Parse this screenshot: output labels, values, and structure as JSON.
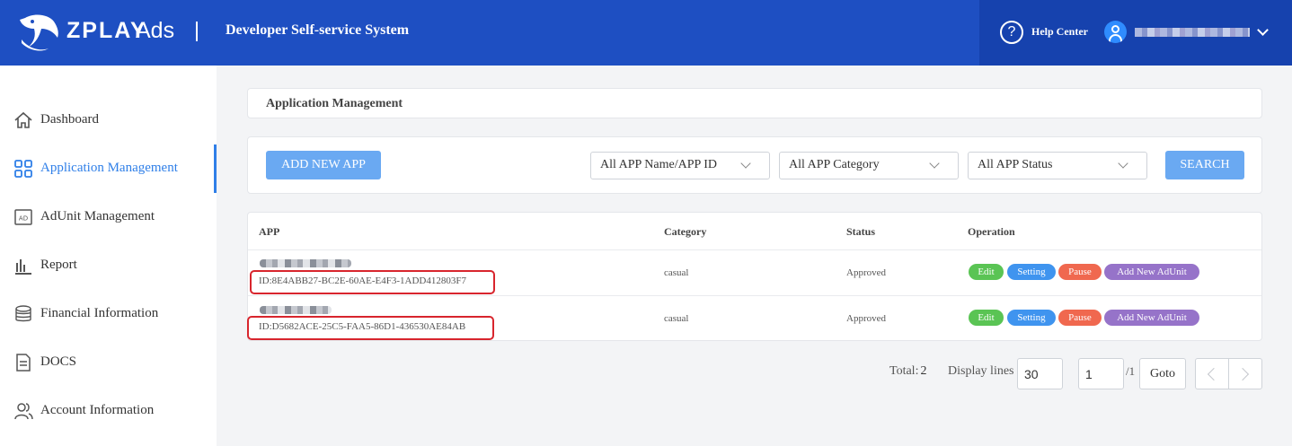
{
  "header": {
    "logo_word": "ZPLAY",
    "logo_ads": "Ads",
    "system_title": "Developer Self-service System",
    "help_icon_glyph": "?",
    "help_label": "Help Center",
    "user_icon": "user-icon",
    "dropdown_icon": "chevron-down-icon",
    "colors": {
      "header_bg": "#1e4fc2",
      "header_right_bg": "#1642ae",
      "accent": "#2f7fe8"
    }
  },
  "sidebar": {
    "items": [
      {
        "label": "Dashboard",
        "icon": "home-icon"
      },
      {
        "label": "Application Management",
        "icon": "grid-icon",
        "active": true
      },
      {
        "label": "AdUnit Management",
        "icon": "ad-icon"
      },
      {
        "label": "Report",
        "icon": "bar-chart-icon"
      },
      {
        "label": "Financial Information",
        "icon": "coins-icon"
      },
      {
        "label": "DOCS",
        "icon": "document-icon"
      },
      {
        "label": "Account Information",
        "icon": "users-icon"
      }
    ]
  },
  "breadcrumb": {
    "title": "Application Management"
  },
  "filters": {
    "add_button": "ADD NEW APP",
    "app_select": "All APP Name/APP ID",
    "category_select": "All APP Category",
    "status_select": "All APP Status",
    "search_button": "SEARCH"
  },
  "table": {
    "headers": {
      "app": "APP",
      "category": "Category",
      "status": "Status",
      "operation": "Operation"
    },
    "rows": [
      {
        "app_id": "ID:8E4ABB27-BC2E-60AE-E4F3-1ADD412803F7",
        "category": "casual",
        "status": "Approved"
      },
      {
        "app_id": "ID:D5682ACE-25C5-FAA5-86D1-436530AE84AB",
        "category": "casual",
        "status": "Approved"
      }
    ],
    "operations": {
      "edit": "Edit",
      "setting": "Setting",
      "pause": "Pause",
      "add_unit": "Add New AdUnit"
    }
  },
  "pagination": {
    "total_label": "Total:",
    "total_value": "2",
    "display_lines_label": "Display lines",
    "display_lines_value": "30",
    "page_value": "1",
    "page_total": "/1",
    "goto_label": "Goto",
    "prev_icon": "chevron-left-icon",
    "next_icon": "chevron-right-icon"
  }
}
